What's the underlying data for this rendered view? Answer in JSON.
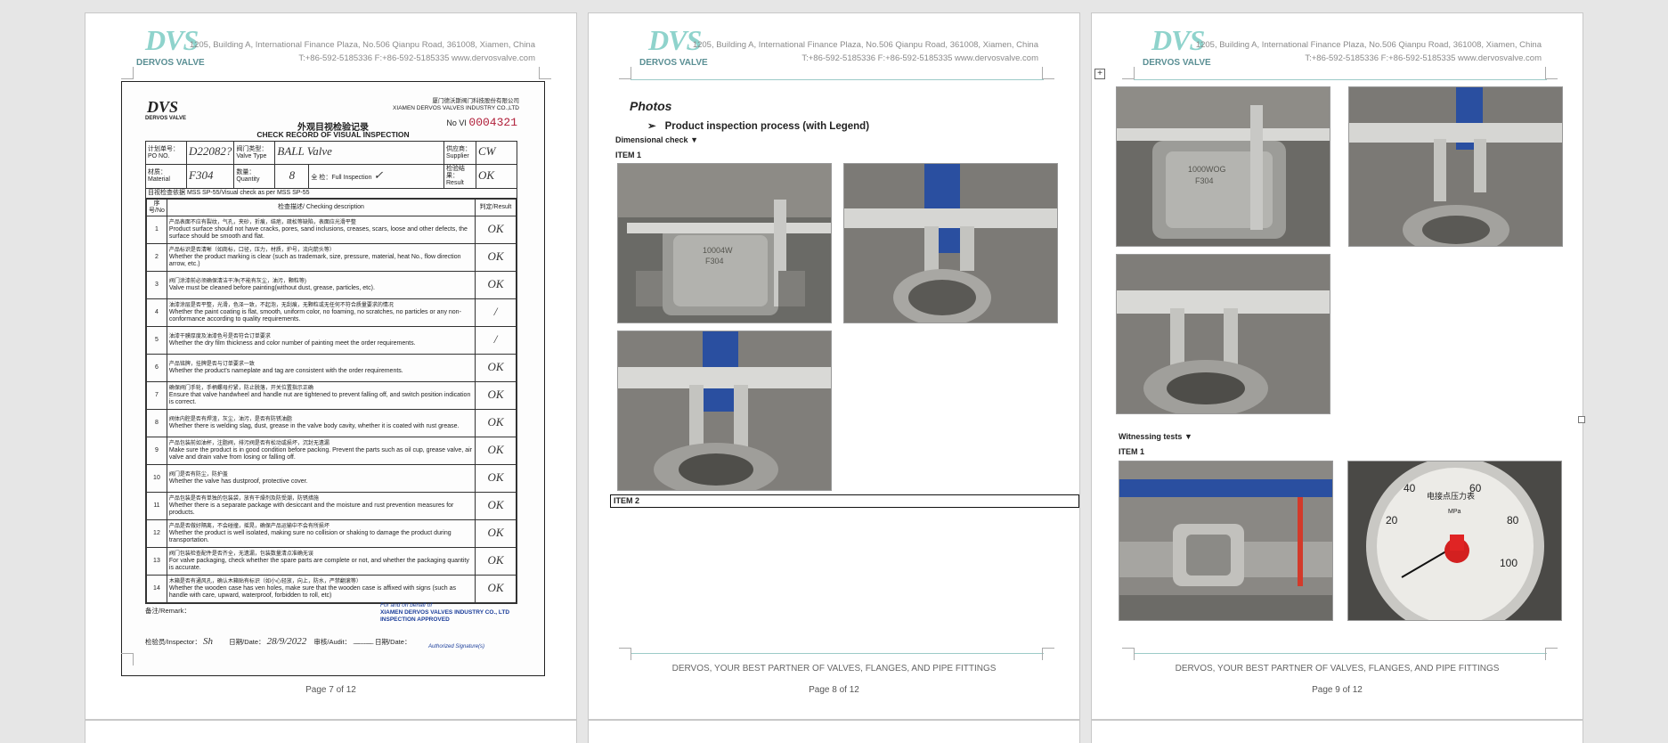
{
  "company": {
    "logo_mark": "DVS",
    "logo_name": "DERVOS VALVE",
    "address_line1": "1205, Building A, International Finance Plaza, No.506 Qianpu Road, 361008, Xiamen, China",
    "address_line2": "T:+86-592-5185336   F:+86-592-5185335   www.dervosvalve.com",
    "footer_slogan": "DERVOS, YOUR BEST PARTNER OF VALVES, FLANGES, AND PIPE FITTINGS"
  },
  "pages": {
    "p7": {
      "number": "Page 7 of 12"
    },
    "p8": {
      "number": "Page 8 of 12"
    },
    "p9": {
      "number": "Page 9 of 12"
    }
  },
  "record": {
    "logo": "DVS",
    "logo_sub": "DERVOS VALVE",
    "company_cn": "厦门德沃斯阀门科技股份有限公司",
    "company_en": "XIAMEN DERVOS VALVES INDUSTRY CO.,LTD",
    "no_label": "No VI",
    "no_value": "0004321",
    "title_cn": "外观目视检验记录",
    "title_en": "CHECK RECORD OF VISUAL INSPECTION",
    "po_label": "计划单号：PO NO.",
    "po_value": "D22082?",
    "valve_type_label": "阀门类型：Valve Type",
    "valve_type_value": "BALL  Valve",
    "supplier_label": "供应商：Supplier",
    "supplier_value": "CW",
    "material_label": "材质：Material",
    "material_value": "F304",
    "quantity_label": "数量：Quantity",
    "quantity_value": "8",
    "full_label": "全 检：Full Inspection",
    "full_value": "✓",
    "result_label": "检验结果：Result",
    "result_value": "OK",
    "basis": "目视检查依据 MSS SP-55/Visual check as per  MSS SP-55",
    "col_no": "序号/No",
    "col_desc": "检查描述/ Checking description",
    "col_result": "判定/Result",
    "items": [
      {
        "no": "1",
        "cn": "产品表面不应有裂纹，气孔，夹砂，折痕，结疤，疏松等缺陷，表面应光滑平整",
        "en": "Product surface should not have cracks, pores, sand inclusions, creases, scars, loose and other defects, the surface should be smooth and flat.",
        "result": "OK"
      },
      {
        "no": "2",
        "cn": "产品标识是否清晰（如商标，口径，压力，材质，炉号，流向箭头等）",
        "en": "Whether the product marking is clear (such as trademark, size, pressure, material, heat No., flow direction arrow, etc.)",
        "result": "OK"
      },
      {
        "no": "3",
        "cn": "阀门涂漆前必须确保清洁干净(不能有灰尘，油污，颗粒等)",
        "en": "Valve must be cleaned before painting(without dust, grease, particles, etc).",
        "result": "OK"
      },
      {
        "no": "4",
        "cn": "油漆涂层是否平整，光滑，色泽一致，不起泡，无刮痕，无颗粒或无任何不符合质量要求的情况",
        "en": "Whether the paint coating is flat, smooth, uniform color, no foaming, no scratches, no particles or any non-conformance according to quality requirements.",
        "result": "/"
      },
      {
        "no": "5",
        "cn": "油漆干膜厚度及油漆色号是否符合订单要求",
        "en": "Whether the dry film thickness and color number of painting meet the order requirements.",
        "result": "/"
      },
      {
        "no": "6",
        "cn": "产品铭牌，挂牌是否与订单要求一致",
        "en": "Whether the product's nameplate and tag are consistent with the order requirements.",
        "result": "OK"
      },
      {
        "no": "7",
        "cn": "确保阀门手轮，手柄螺母拧紧，防止脱落，开关位置指示正确",
        "en": "Ensure that valve handwheel and handle nut are tightened to prevent falling off, and switch position indication is correct.",
        "result": "OK"
      },
      {
        "no": "8",
        "cn": "阀体内腔是否有焊渣，灰尘，油污，是否有防锈油脂",
        "en": "Whether there is welding slag, dust, grease in the valve body cavity, whether it is coated with rust grease.",
        "result": "OK"
      },
      {
        "no": "9",
        "cn": "产品包装前如油杯，注脂阀，排污阀是否有松动或损坏，沉封无遗漏",
        "en": "Make sure the product is in good condition before packing. Prevent the parts such as oil cup, grease valve, air valve and drain valve from losing or falling off.",
        "result": "OK"
      },
      {
        "no": "10",
        "cn": "阀门是否有防尘，防护盖",
        "en": "Whether the valve has dustproof, protective cover.",
        "result": "OK"
      },
      {
        "no": "11",
        "cn": "产品包装是否有单独的包装袋，放有干燥剂及防受潮，防锈措施",
        "en": "Whether there is a separate package with desiccant and the moisture and rust prevention measures for products.",
        "result": "OK"
      },
      {
        "no": "12",
        "cn": "产品是否做好隔离，不会碰撞，摇晃，确保产品运输中不会有所损坏",
        "en": "Whether the product is well isolated, making sure no collision or shaking to damage the product during transportation.",
        "result": "OK"
      },
      {
        "no": "13",
        "cn": "阀门包装检查配件是否齐全，无遗漏，包装数量清点准确无误",
        "en": "For valve packaging, check whether the spare parts are complete or not, and whether the packaging quantity is accurate.",
        "result": "OK"
      },
      {
        "no": "14",
        "cn": "木箱是否有通风孔，确认木箱贴有标识（如小心轻放，向上，防水，严禁翻滚等）",
        "en": "Whether the wooden case has ven holes, make sure that the wooden case is affixed with signs (such as handle with care, upward, waterproof,  forbidden to roll, etc)",
        "result": "OK"
      }
    ],
    "remark": "备注/Remark：",
    "stamp_line1": "For and on behalf of",
    "stamp_line2": "XIAMEN DERVOS VALVES INDUSTRY CO., LTD",
    "stamp_line3": "INSPECTION  APPROVED",
    "inspector": "检验员/Inspector：",
    "date": "日期/Date：",
    "date_value": "28/9/2022",
    "audit": "审核/Audit：",
    "date2": "日期/Date：",
    "authorized": "Authorized Signature(s)"
  },
  "p8": {
    "photos_heading": "Photos",
    "bullet_mark": "➢",
    "bullet_text": "Product inspection process (with Legend)",
    "dim_check": "Dimensional check",
    "dim_arrow": "▼",
    "item1": "ITEM   1",
    "item2": "ITEM 2"
  },
  "p9": {
    "witness": "Witnessing tests",
    "witness_arrow": "▼",
    "item1": "ITEM   1",
    "gauge_text": "电接点压力表",
    "gauge_unit": "MPa",
    "gauge_ticks": [
      "20",
      "40",
      "60",
      "80",
      "100"
    ]
  },
  "colors": {
    "logo": "#8fd3cc",
    "rule": "#9dcbc8",
    "stamp": "#1a3d9a",
    "serial": "#b0203a"
  }
}
